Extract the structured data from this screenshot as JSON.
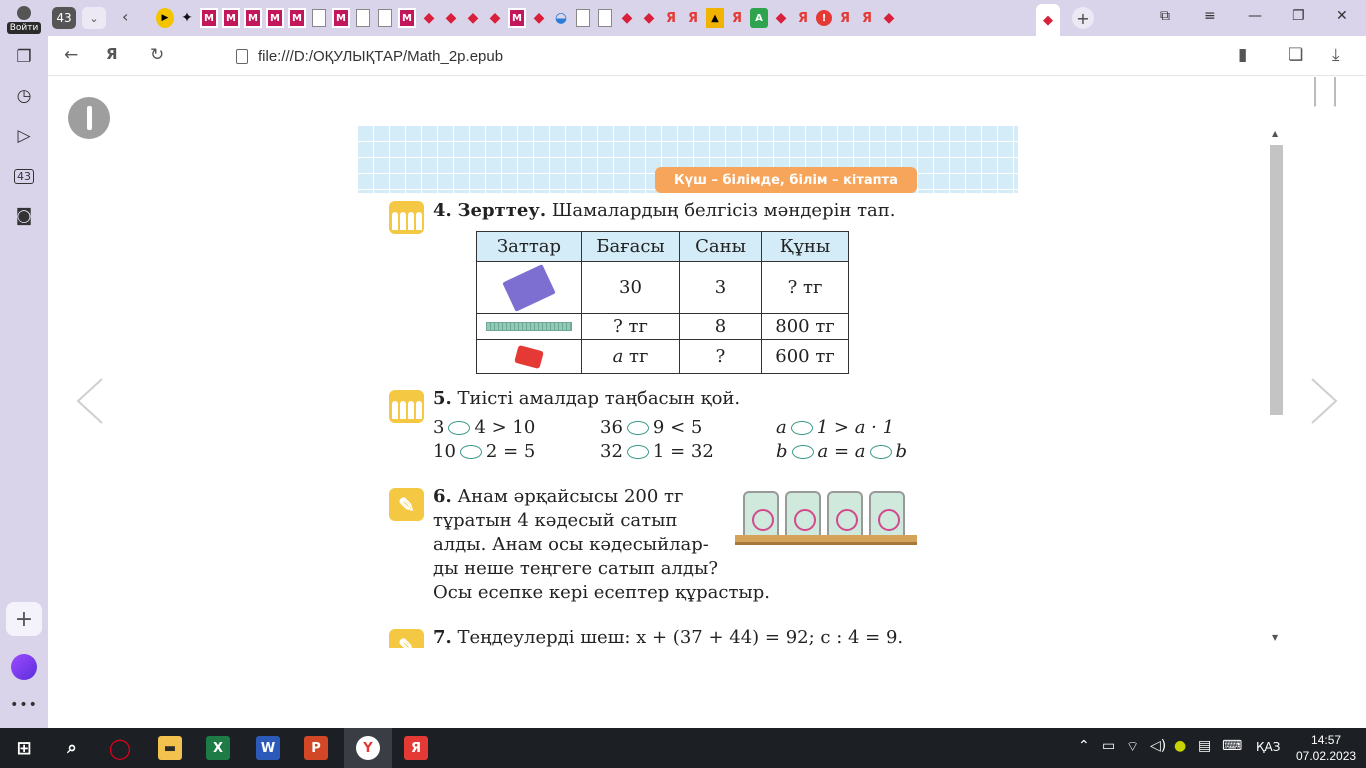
{
  "sidebar": {
    "login_label": "Войти",
    "tab_count_badge": "43",
    "icons": [
      "collections-icon",
      "history-icon",
      "video-icon",
      "tabs-43-icon",
      "screenshot-icon"
    ]
  },
  "tabbar": {
    "tab_count": "43",
    "new_tab_symbol": "+"
  },
  "address_bar": {
    "url": "file:///D:/ОҚУЛЫҚТАР/Math_2p.epub"
  },
  "page": {
    "motto": "Күш – білімде, білім – кітапта",
    "task4": {
      "number": "4.",
      "title": "Зерттеу.",
      "text": " Шамалардың белгісіз мәндерін тап.",
      "table": {
        "headers": [
          "Заттар",
          "Бағасы",
          "Саны",
          "Құны"
        ],
        "rows": [
          {
            "item": "notebook",
            "price": "30",
            "count": "3",
            "cost": "? тг"
          },
          {
            "item": "ruler",
            "price": "? тг",
            "count": "8",
            "cost": "800 тг"
          },
          {
            "item": "sharpener",
            "price_var": "a",
            "price_unit": " тг",
            "count": "?",
            "cost": "600 тг"
          }
        ]
      }
    },
    "task5": {
      "number": "5.",
      "text": " Тиісті амалдар таңбасын қой.",
      "row1": [
        {
          "a": "3",
          "b": "4 > 10"
        },
        {
          "a": "36",
          "b": "9 < 5"
        },
        {
          "a": "a",
          "b": "1 > a · 1"
        }
      ],
      "row2": [
        {
          "a": "10",
          "b": "2 = 5"
        },
        {
          "a": "32",
          "b": "1 = 32"
        },
        {
          "a": "b",
          "b": "a = a",
          "c": "b"
        }
      ]
    },
    "task6": {
      "number": "6.",
      "lines": [
        " Анам әрқайсысы 200 тг",
        "тұратын 4 кәдесый сатып",
        "алды. Анам осы кәдесыйлар-",
        "ды неше теңгеге сатып алды?",
        "Осы есепке кері есептер құрастыр."
      ]
    },
    "task7": {
      "number": "7.",
      "text": " Теңдеулерді шеш: x + (37 + 44) = 92; c : 4 = 9."
    }
  },
  "taskbar": {
    "language": "ҚАЗ",
    "time": "14:57",
    "date": "07.02.2023"
  }
}
